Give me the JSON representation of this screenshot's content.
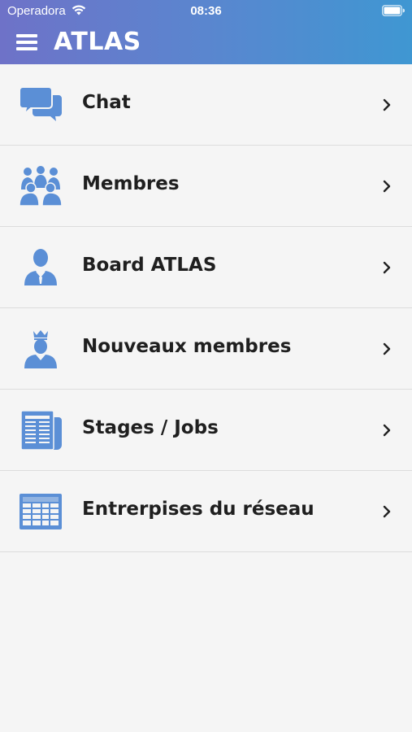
{
  "status_bar": {
    "carrier": "Operadora",
    "time": "08:36",
    "wifi_icon": "wifi-icon",
    "battery_icon": "battery-icon"
  },
  "nav": {
    "title": "ATLAS",
    "menu_icon": "hamburger-menu-icon"
  },
  "colors": {
    "header_gradient_start": "#6e72c8",
    "header_gradient_end": "#3f97d2",
    "icon_blue": "#5b8fd6",
    "background": "#f5f5f5",
    "divider": "#dcdcdc"
  },
  "menu": {
    "items": [
      {
        "label": "Chat",
        "icon": "chat-bubbles-icon"
      },
      {
        "label": "Membres",
        "icon": "group-people-icon"
      },
      {
        "label": "Board ATLAS",
        "icon": "business-person-icon"
      },
      {
        "label": "Nouveaux membres",
        "icon": "crowned-person-icon"
      },
      {
        "label": "Stages / Jobs",
        "icon": "newspaper-icon"
      },
      {
        "label": "Entrerpises du réseau",
        "icon": "building-grid-icon"
      }
    ]
  }
}
